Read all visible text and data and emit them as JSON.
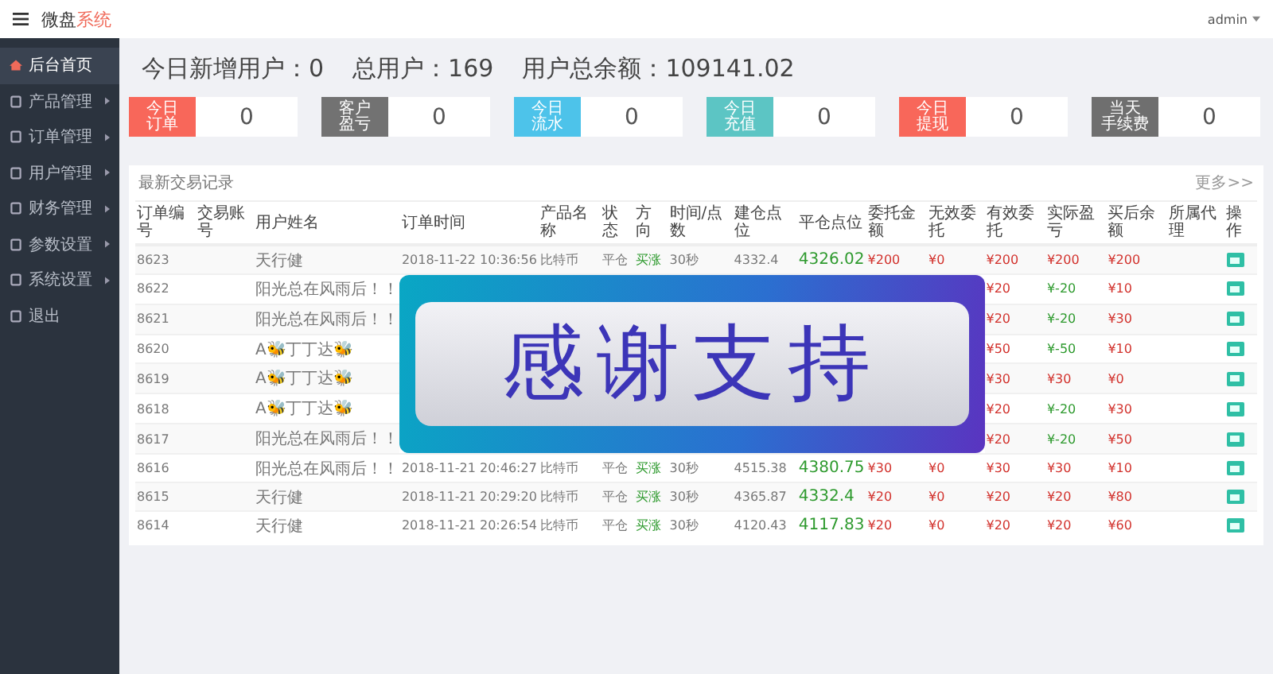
{
  "header": {
    "brand": "微盘",
    "brand_accent": "系统",
    "user": "admin"
  },
  "sidebar": [
    {
      "label": "后台首页",
      "selected": true,
      "has_submenu": false
    },
    {
      "label": "产品管理",
      "selected": false,
      "has_submenu": true
    },
    {
      "label": "订单管理",
      "selected": false,
      "has_submenu": true
    },
    {
      "label": "用户管理",
      "selected": false,
      "has_submenu": true
    },
    {
      "label": "财务管理",
      "selected": false,
      "has_submenu": true
    },
    {
      "label": "参数设置",
      "selected": false,
      "has_submenu": true
    },
    {
      "label": "系统设置",
      "selected": false,
      "has_submenu": true
    },
    {
      "label": "退出",
      "selected": false,
      "has_submenu": false
    }
  ],
  "stats": [
    {
      "label": "今日新增用户：",
      "value": "0"
    },
    {
      "label": "总用户：",
      "value": "169"
    },
    {
      "label": "用户总余额：",
      "value": "109141.02"
    }
  ],
  "cards": [
    {
      "lines": [
        "今日",
        "订单"
      ],
      "value": "0",
      "color": "#f8675a"
    },
    {
      "lines": [
        "客户",
        "盈亏"
      ],
      "value": "0",
      "color": "#727272"
    },
    {
      "lines": [
        "今日",
        "流水"
      ],
      "value": "0",
      "color": "#4dc3ea"
    },
    {
      "lines": [
        "今日",
        "充值"
      ],
      "value": "0",
      "color": "#5cc5c4"
    },
    {
      "lines": [
        "今日",
        "提现"
      ],
      "value": "0",
      "color": "#f8675a"
    },
    {
      "lines": [
        "当天",
        "手续费"
      ],
      "value": "0",
      "color": "#6f6f6f"
    }
  ],
  "table": {
    "title": "最新交易记录",
    "more": "更多>>",
    "columns": [
      "订单编号",
      "交易账号",
      "用户姓名",
      "订单时间",
      "产品名称",
      "状态",
      "方向",
      "时间/点数",
      "建仓点位",
      "平仓点位",
      "委托金额",
      "无效委托",
      "有效委托",
      "实际盈亏",
      "买后余额",
      "所属代理",
      "操作"
    ],
    "rows": [
      {
        "hidden": false,
        "no": "8623",
        "user": "天行健",
        "time": "2018-11-22 10:36:56",
        "product": "比特币",
        "status": "平仓",
        "direction": "买涨",
        "period": "30秒",
        "open": "4332.4",
        "close": "4326.02",
        "amount": "¥200",
        "invalid": "¥0",
        "valid": "¥200",
        "profit": "¥200",
        "loss": false,
        "balance": "¥200"
      },
      {
        "hidden": true,
        "no": "8622",
        "user": "阳光总在风雨后！！",
        "valid": "¥20",
        "profit": "¥-20",
        "loss": true,
        "balance": "¥10"
      },
      {
        "hidden": true,
        "no": "8621",
        "user": "阳光总在风雨后！！",
        "valid": "¥20",
        "profit": "¥-20",
        "loss": true,
        "balance": "¥30"
      },
      {
        "hidden": true,
        "no": "8620",
        "user": "A🐝丁丁达🐝",
        "valid": "¥50",
        "profit": "¥-50",
        "loss": true,
        "balance": "¥10"
      },
      {
        "hidden": true,
        "no": "8619",
        "user": "A🐝丁丁达🐝",
        "valid": "¥30",
        "profit": "¥30",
        "loss": false,
        "balance": "¥0"
      },
      {
        "hidden": true,
        "no": "8618",
        "user": "A🐝丁丁达🐝",
        "valid": "¥20",
        "profit": "¥-20",
        "loss": true,
        "balance": "¥30"
      },
      {
        "hidden": true,
        "no": "8617",
        "user": "阳光总在风雨后！！",
        "valid": "¥20",
        "profit": "¥-20",
        "loss": true,
        "balance": "¥50"
      },
      {
        "hidden": false,
        "no": "8616",
        "user": "阳光总在风雨后！！",
        "time": "2018-11-21 20:46:27",
        "product": "比特币",
        "status": "平仓",
        "direction": "买涨",
        "period": "30秒",
        "open": "4515.38",
        "close": "4380.75",
        "amount": "¥30",
        "invalid": "¥0",
        "valid": "¥30",
        "profit": "¥30",
        "loss": false,
        "balance": "¥10"
      },
      {
        "hidden": false,
        "no": "8615",
        "user": "天行健",
        "time": "2018-11-21 20:29:20",
        "product": "比特币",
        "status": "平仓",
        "direction": "买涨",
        "period": "30秒",
        "open": "4365.87",
        "close": "4332.4",
        "amount": "¥20",
        "invalid": "¥0",
        "valid": "¥20",
        "profit": "¥20",
        "loss": false,
        "balance": "¥80"
      },
      {
        "hidden": false,
        "no": "8614",
        "user": "天行健",
        "time": "2018-11-21 20:26:54",
        "product": "比特币",
        "status": "平仓",
        "direction": "买涨",
        "period": "30秒",
        "open": "4120.43",
        "close": "4117.83",
        "amount": "¥20",
        "invalid": "¥0",
        "valid": "¥20",
        "profit": "¥20",
        "loss": false,
        "balance": "¥60"
      }
    ]
  },
  "banner": {
    "text": "感谢支持"
  }
}
